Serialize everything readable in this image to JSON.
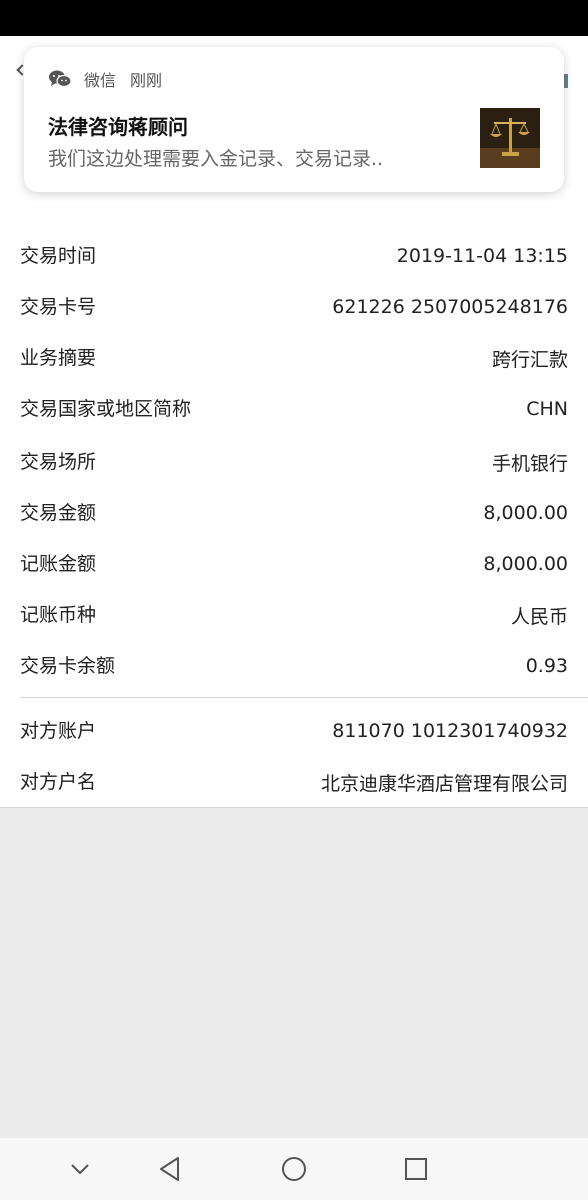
{
  "notification": {
    "app_name": "微信",
    "time": "刚刚",
    "title": "法律咨询蒋顾问",
    "body": "我们这边处理需要入金记录、交易记录.."
  },
  "transaction": {
    "rows": [
      {
        "label": "交易时间",
        "value": "2019-11-04 13:15"
      },
      {
        "label": "交易卡号",
        "value": "621226 2507005248176"
      },
      {
        "label": "业务摘要",
        "value": "跨行汇款"
      },
      {
        "label": "交易国家或地区简称",
        "value": "CHN"
      },
      {
        "label": "交易场所",
        "value": "手机银行"
      },
      {
        "label": "交易金额",
        "value": "8,000.00"
      },
      {
        "label": "记账金额",
        "value": "8,000.00"
      },
      {
        "label": "记账币种",
        "value": "人民币"
      },
      {
        "label": "交易卡余额",
        "value": "0.93"
      }
    ],
    "counterparty": [
      {
        "label": "对方账户",
        "value": "811070 1012301740932"
      },
      {
        "label": "对方户名",
        "value": "北京迪康华酒店管理有限公司"
      }
    ]
  },
  "icons": {
    "notification": "wechat-icon",
    "thumbnail": "scales-of-justice-image",
    "nav": [
      "chevron-down-icon",
      "back-triangle-icon",
      "home-circle-icon",
      "recents-square-icon"
    ]
  }
}
